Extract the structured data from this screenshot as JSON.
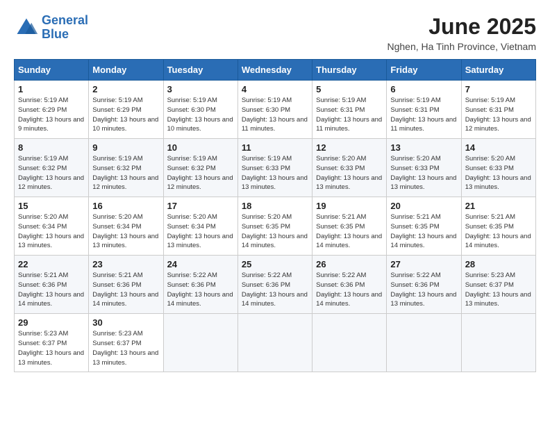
{
  "logo": {
    "line1": "General",
    "line2": "Blue"
  },
  "title": "June 2025",
  "subtitle": "Nghen, Ha Tinh Province, Vietnam",
  "weekdays": [
    "Sunday",
    "Monday",
    "Tuesday",
    "Wednesday",
    "Thursday",
    "Friday",
    "Saturday"
  ],
  "weeks": [
    [
      {
        "day": "1",
        "sunrise": "5:19 AM",
        "sunset": "6:29 PM",
        "daylight": "13 hours and 9 minutes."
      },
      {
        "day": "2",
        "sunrise": "5:19 AM",
        "sunset": "6:29 PM",
        "daylight": "13 hours and 10 minutes."
      },
      {
        "day": "3",
        "sunrise": "5:19 AM",
        "sunset": "6:30 PM",
        "daylight": "13 hours and 10 minutes."
      },
      {
        "day": "4",
        "sunrise": "5:19 AM",
        "sunset": "6:30 PM",
        "daylight": "13 hours and 11 minutes."
      },
      {
        "day": "5",
        "sunrise": "5:19 AM",
        "sunset": "6:31 PM",
        "daylight": "13 hours and 11 minutes."
      },
      {
        "day": "6",
        "sunrise": "5:19 AM",
        "sunset": "6:31 PM",
        "daylight": "13 hours and 11 minutes."
      },
      {
        "day": "7",
        "sunrise": "5:19 AM",
        "sunset": "6:31 PM",
        "daylight": "13 hours and 12 minutes."
      }
    ],
    [
      {
        "day": "8",
        "sunrise": "5:19 AM",
        "sunset": "6:32 PM",
        "daylight": "13 hours and 12 minutes."
      },
      {
        "day": "9",
        "sunrise": "5:19 AM",
        "sunset": "6:32 PM",
        "daylight": "13 hours and 12 minutes."
      },
      {
        "day": "10",
        "sunrise": "5:19 AM",
        "sunset": "6:32 PM",
        "daylight": "13 hours and 12 minutes."
      },
      {
        "day": "11",
        "sunrise": "5:19 AM",
        "sunset": "6:33 PM",
        "daylight": "13 hours and 13 minutes."
      },
      {
        "day": "12",
        "sunrise": "5:20 AM",
        "sunset": "6:33 PM",
        "daylight": "13 hours and 13 minutes."
      },
      {
        "day": "13",
        "sunrise": "5:20 AM",
        "sunset": "6:33 PM",
        "daylight": "13 hours and 13 minutes."
      },
      {
        "day": "14",
        "sunrise": "5:20 AM",
        "sunset": "6:33 PM",
        "daylight": "13 hours and 13 minutes."
      }
    ],
    [
      {
        "day": "15",
        "sunrise": "5:20 AM",
        "sunset": "6:34 PM",
        "daylight": "13 hours and 13 minutes."
      },
      {
        "day": "16",
        "sunrise": "5:20 AM",
        "sunset": "6:34 PM",
        "daylight": "13 hours and 13 minutes."
      },
      {
        "day": "17",
        "sunrise": "5:20 AM",
        "sunset": "6:34 PM",
        "daylight": "13 hours and 13 minutes."
      },
      {
        "day": "18",
        "sunrise": "5:20 AM",
        "sunset": "6:35 PM",
        "daylight": "13 hours and 14 minutes."
      },
      {
        "day": "19",
        "sunrise": "5:21 AM",
        "sunset": "6:35 PM",
        "daylight": "13 hours and 14 minutes."
      },
      {
        "day": "20",
        "sunrise": "5:21 AM",
        "sunset": "6:35 PM",
        "daylight": "13 hours and 14 minutes."
      },
      {
        "day": "21",
        "sunrise": "5:21 AM",
        "sunset": "6:35 PM",
        "daylight": "13 hours and 14 minutes."
      }
    ],
    [
      {
        "day": "22",
        "sunrise": "5:21 AM",
        "sunset": "6:36 PM",
        "daylight": "13 hours and 14 minutes."
      },
      {
        "day": "23",
        "sunrise": "5:21 AM",
        "sunset": "6:36 PM",
        "daylight": "13 hours and 14 minutes."
      },
      {
        "day": "24",
        "sunrise": "5:22 AM",
        "sunset": "6:36 PM",
        "daylight": "13 hours and 14 minutes."
      },
      {
        "day": "25",
        "sunrise": "5:22 AM",
        "sunset": "6:36 PM",
        "daylight": "13 hours and 14 minutes."
      },
      {
        "day": "26",
        "sunrise": "5:22 AM",
        "sunset": "6:36 PM",
        "daylight": "13 hours and 14 minutes."
      },
      {
        "day": "27",
        "sunrise": "5:22 AM",
        "sunset": "6:36 PM",
        "daylight": "13 hours and 13 minutes."
      },
      {
        "day": "28",
        "sunrise": "5:23 AM",
        "sunset": "6:37 PM",
        "daylight": "13 hours and 13 minutes."
      }
    ],
    [
      {
        "day": "29",
        "sunrise": "5:23 AM",
        "sunset": "6:37 PM",
        "daylight": "13 hours and 13 minutes."
      },
      {
        "day": "30",
        "sunrise": "5:23 AM",
        "sunset": "6:37 PM",
        "daylight": "13 hours and 13 minutes."
      },
      null,
      null,
      null,
      null,
      null
    ]
  ],
  "labels": {
    "sunrise": "Sunrise:",
    "sunset": "Sunset:",
    "daylight": "Daylight:"
  },
  "colors": {
    "header_bg": "#2a6db5",
    "accent": "#1a3a5c"
  }
}
